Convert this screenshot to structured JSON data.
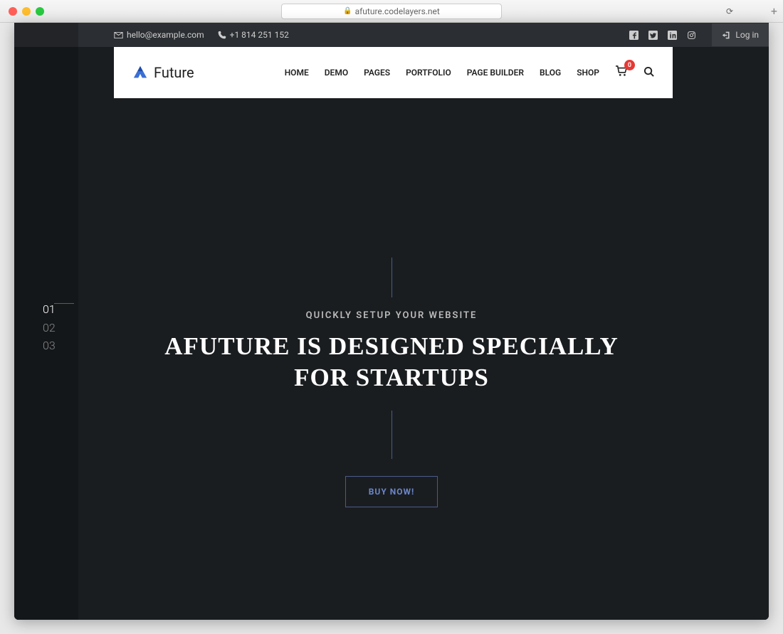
{
  "browser": {
    "url": "afuture.codelayers.net"
  },
  "topbar": {
    "email": "hello@example.com",
    "phone": "+1 814 251 152",
    "login_label": "Log in"
  },
  "logo": {
    "text": "Future"
  },
  "nav": {
    "items": [
      "HOME",
      "DEMO",
      "PAGES",
      "PORTFOLIO",
      "PAGE BUILDER",
      "BLOG",
      "SHOP"
    ],
    "cart_count": "0"
  },
  "hero": {
    "subtitle": "QUICKLY SETUP YOUR WEBSITE",
    "headline": "AFUTURE IS DESIGNED SPECIALLY FOR STARTUPS",
    "cta": "BUY NOW!"
  },
  "slides": {
    "items": [
      "01",
      "02",
      "03"
    ],
    "active": 0
  }
}
